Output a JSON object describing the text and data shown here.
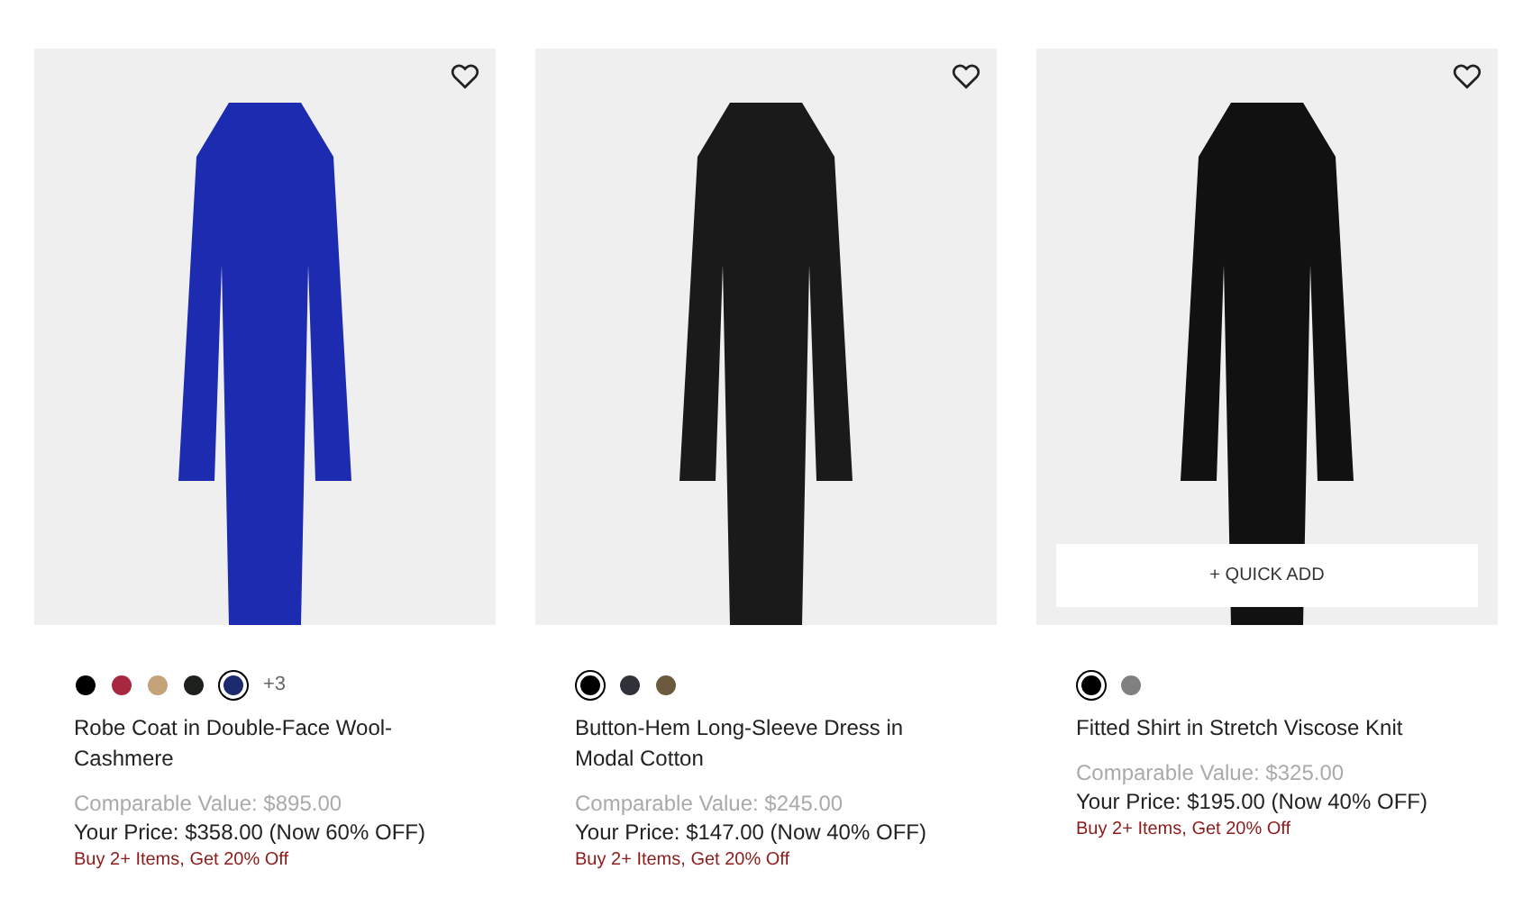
{
  "products": [
    {
      "name": "Robe Coat in Double-Face Wool-Cashmere",
      "swatches": [
        {
          "color": "#000000",
          "selected": false
        },
        {
          "color": "#a8283f",
          "selected": false
        },
        {
          "color": "#c4a27a",
          "selected": false
        },
        {
          "color": "#1e201c",
          "selected": false
        },
        {
          "color": "#1c2a6e",
          "selected": true
        }
      ],
      "more_colors": "+3",
      "comparable": "Comparable Value: $895.00",
      "price": "Your Price: $358.00 (Now 60% OFF)",
      "promo": "Buy 2+ Items, Get 20% Off",
      "color": "#1d2bb0"
    },
    {
      "name": "Button-Hem Long-Sleeve Dress in Modal Cotton",
      "swatches": [
        {
          "color": "#000000",
          "selected": true
        },
        {
          "color": "#30323a",
          "selected": false
        },
        {
          "color": "#6b5a3e",
          "selected": false
        }
      ],
      "comparable": "Comparable Value: $245.00",
      "price": "Your Price: $147.00 (Now 40% OFF)",
      "promo": "Buy 2+ Items, Get 20% Off",
      "color": "#1a1a1a"
    },
    {
      "name": "Fitted Shirt in Stretch Viscose Knit",
      "swatches": [
        {
          "color": "#000000",
          "selected": true
        },
        {
          "color": "#808080",
          "selected": false
        }
      ],
      "comparable": "Comparable Value: $325.00",
      "price": "Your Price: $195.00 (Now 40% OFF)",
      "promo": "Buy 2+ Items, Get 20% Off",
      "color": "#111111",
      "quick_add": "+ QUICK ADD"
    }
  ]
}
